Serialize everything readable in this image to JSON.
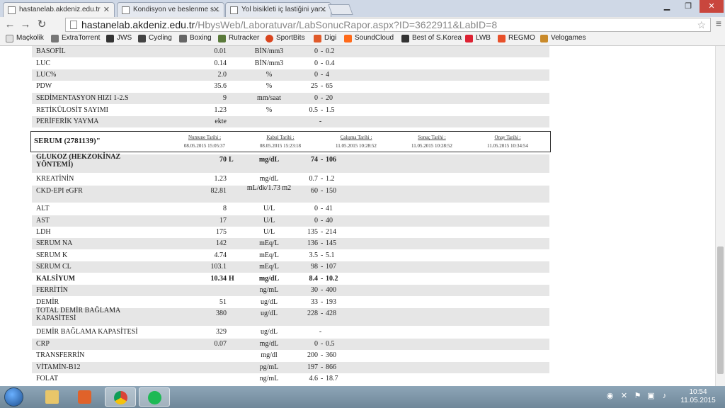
{
  "browser": {
    "tabs": [
      {
        "title": "hastanelab.akdeniz.edu.tr",
        "active": true
      },
      {
        "title": "Kondisyon ve beslenme s...",
        "active": false
      },
      {
        "title": "Yol bisikleti iç lastiğini yar...",
        "active": false
      }
    ],
    "address": {
      "host": "hastanelab.akdeniz.edu.tr",
      "path": "/HbysWeb/Laboratuvar/LabSonucRapor.aspx?ID=3622911&LabID=8"
    },
    "bookmarks": [
      "Maçkolik",
      "ExtraTorrent",
      "JWS",
      "Cycling",
      "Boxing",
      "Rutracker",
      "SportBits",
      "Digi",
      "SoundCloud",
      "Best of S.Korea",
      "LWB",
      "REGMO",
      "Velogames"
    ]
  },
  "colors": {
    "row_shade": "#e6e6e6",
    "taskbar": "#7f97a9"
  },
  "upper": [
    {
      "name": "BASOFİL",
      "value": "0.01",
      "unit": "BİN/mm3",
      "lo": "0",
      "hi": "0.2"
    },
    {
      "name": "LUC",
      "value": "0.14",
      "unit": "BİN/mm3",
      "lo": "0",
      "hi": "0.4"
    },
    {
      "name": "LUC%",
      "value": "2.0",
      "unit": "%",
      "lo": "0",
      "hi": "4"
    },
    {
      "name": "PDW",
      "value": "35.6",
      "unit": "%",
      "lo": "25",
      "hi": "65"
    },
    {
      "name": "SEDİMENTASYON HIZI 1-2.S",
      "value": "9",
      "unit": "mm/saat",
      "lo": "0",
      "hi": "20"
    },
    {
      "name": "RETİKÜLOSİT SAYIMI",
      "value": "1.23",
      "unit": "%",
      "lo": "0.5",
      "hi": "1.5"
    },
    {
      "name": "PERİFERİK YAYMA",
      "value": "ekte",
      "unit": "",
      "single": "-"
    }
  ],
  "serum": {
    "title": "SERUM (2781139)\"",
    "cols": [
      {
        "label": "Numune Tarihi :",
        "date": "08.05.2015 15:05:37"
      },
      {
        "label": "Kabul Tarihi :",
        "date": "08.05.2015 15:23:18"
      },
      {
        "label": "Çalışma Tarihi :",
        "date": "11.05.2015 10:28:52"
      },
      {
        "label": "Sonuç Tarihi :",
        "date": "11.05.2015 10:28:52"
      },
      {
        "label": "Onay Tarihi :",
        "date": "11.05.2015 10:34:54"
      }
    ]
  },
  "lower": [
    {
      "name": "GLUKOZ (HEKZOKİNAZ YÖNTEMİ)",
      "value": "70",
      "flag": "L",
      "unit": "mg/dL",
      "lo": "74",
      "hi": "106",
      "bold": true
    },
    {
      "name": "KREATİNİN",
      "value": "1.23",
      "unit": "mg/dL",
      "lo": "0.7",
      "hi": "1.2"
    },
    {
      "name": "CKD-EPI eGFR",
      "value": "82.81",
      "unit": "mL/dk/1.73 m2",
      "lo": "60",
      "hi": "150"
    },
    {
      "name": "ALT",
      "value": "8",
      "unit": "U/L",
      "lo": "0",
      "hi": "41"
    },
    {
      "name": "AST",
      "value": "17",
      "unit": "U/L",
      "lo": "0",
      "hi": "40"
    },
    {
      "name": "LDH",
      "value": "175",
      "unit": "U/L",
      "lo": "135",
      "hi": "214"
    },
    {
      "name": "SERUM NA",
      "value": "142",
      "unit": "mEq/L",
      "lo": "136",
      "hi": "145"
    },
    {
      "name": "SERUM K",
      "value": "4.74",
      "unit": "mEq/L",
      "lo": "3.5",
      "hi": "5.1"
    },
    {
      "name": "SERUM CL",
      "value": "103.1",
      "unit": "mEq/L",
      "lo": "98",
      "hi": "107"
    },
    {
      "name": "KALSİYUM",
      "value": "10.34",
      "flag": "H",
      "unit": "mg/dL",
      "lo": "8.4",
      "hi": "10.2",
      "bold": true
    },
    {
      "name": "FERRİTİN",
      "value": "",
      "unit": "ng/mL",
      "lo": "30",
      "hi": "400"
    },
    {
      "name": "DEMİR",
      "value": "51",
      "unit": "ug/dL",
      "lo": "33",
      "hi": "193"
    },
    {
      "name": "TOTAL DEMİR BAĞLAMA KAPASİTESİ",
      "value": "380",
      "unit": "ug/dL",
      "lo": "228",
      "hi": "428"
    },
    {
      "name": "DEMİR BAĞLAMA KAPASİTESİ",
      "value": "329",
      "unit": "ug/dL",
      "single": "-"
    },
    {
      "name": "CRP",
      "value": "0.07",
      "unit": "mg/dL",
      "lo": "0",
      "hi": "0.5"
    },
    {
      "name": "TRANSFERRİN",
      "value": "",
      "unit": "mg/dl",
      "lo": "200",
      "hi": "360"
    },
    {
      "name": "VİTAMİN-B12",
      "value": "",
      "unit": "pg/mL",
      "lo": "197",
      "hi": "866"
    },
    {
      "name": "FOLAT",
      "value": "",
      "unit": "ng/mL",
      "lo": "4.6",
      "hi": "18.7"
    }
  ],
  "clock": {
    "time": "10:54",
    "date": "11.05.2015"
  }
}
